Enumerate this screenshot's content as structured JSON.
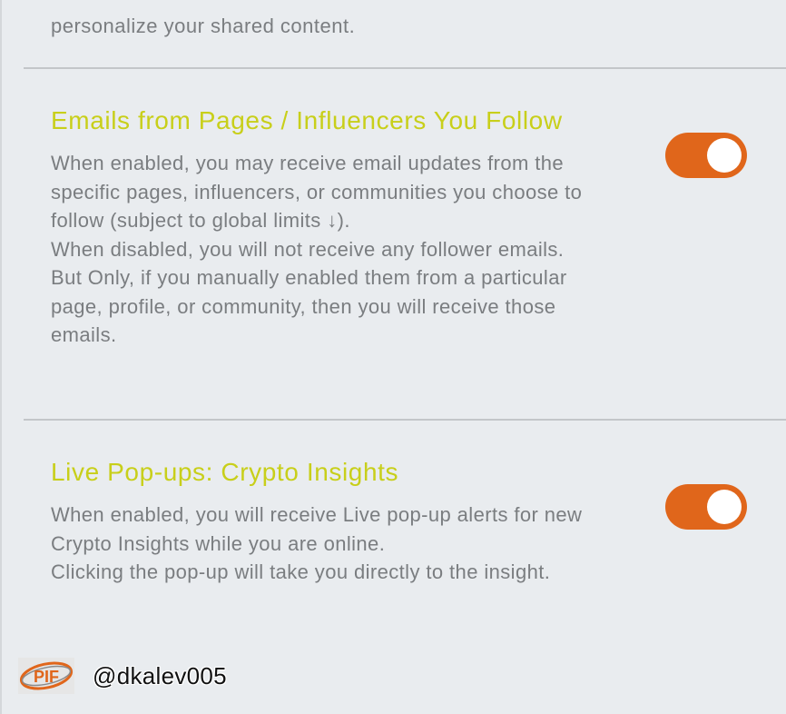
{
  "previous_setting": {
    "desc_tail": "personalize your shared content."
  },
  "settings": [
    {
      "title": "Emails from Pages / Influencers You Follow",
      "description": "When enabled, you may receive email updates from the specific pages, influencers, or communities you choose to follow (subject to global limits ↓).\nWhen disabled, you will not receive any follower emails. But Only, if you manually enabled them from a particular page, profile, or community, then you will receive those emails.",
      "enabled": true
    },
    {
      "title": "Live Pop-ups: Crypto Insights",
      "description": "When enabled, you will receive Live pop-up alerts for new Crypto Insights while you are online.\nClicking the pop-up will take you directly to the insight.",
      "enabled": true
    }
  ],
  "watermark": {
    "logo_text": "PIF",
    "handle": "@dkalev005"
  },
  "colors": {
    "title": "#c8cf1a",
    "toggle_on": "#e0661b",
    "text": "#7a7d80",
    "background": "#e9ecef"
  }
}
